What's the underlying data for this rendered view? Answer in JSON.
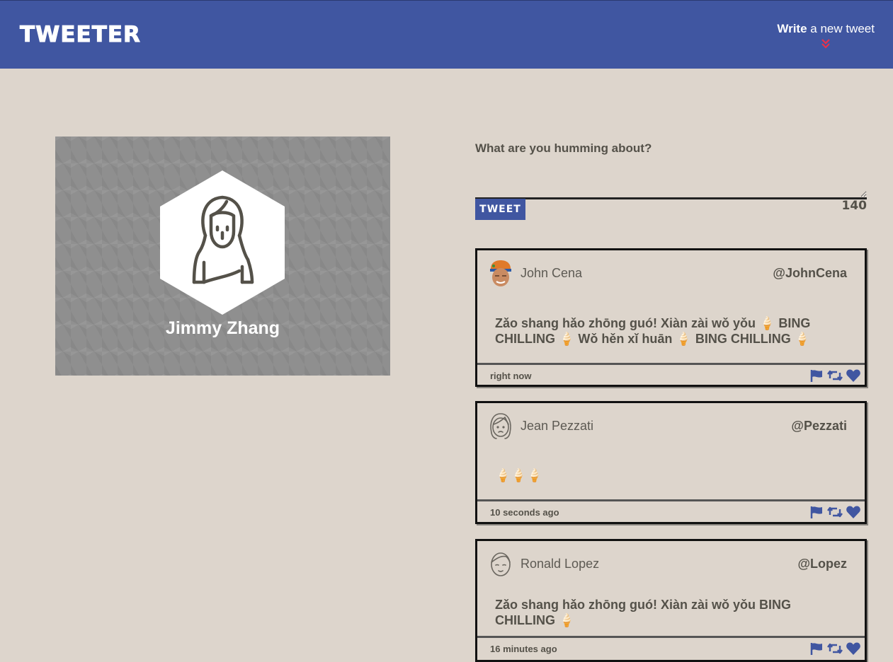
{
  "header": {
    "brand": "TWEETER",
    "compose_bold": "Write",
    "compose_rest": " a new tweet"
  },
  "profile": {
    "name": "Jimmy Zhang"
  },
  "composer": {
    "label": "What are you humming about?",
    "placeholder": "",
    "button": "TWEET",
    "counter": "140"
  },
  "tweets": [
    {
      "name": "John Cena",
      "handle": "@JohnCena",
      "text": "Zǎo shang hǎo zhōng guó! Xiàn zài wǒ yǒu 🍦 BING CHILLING 🍦 Wǒ hěn xǐ huān 🍦 BING CHILLING 🍦",
      "time": "right now",
      "avatar": "photo-avatar"
    },
    {
      "name": "Jean Pezzati",
      "handle": "@Pezzati",
      "text": "🍦🍦🍦",
      "time": "10 seconds ago",
      "avatar": "woman-outline-avatar"
    },
    {
      "name": "Ronald Lopez",
      "handle": "@Lopez",
      "text": "Zǎo shang hǎo zhōng guó! Xiàn zài wǒ yǒu BING CHILLING 🍦",
      "time": "16 minutes ago",
      "avatar": "man-outline-avatar"
    }
  ],
  "colors": {
    "primary": "#4056a1",
    "background": "#ddd5cc",
    "text": "#545149"
  }
}
